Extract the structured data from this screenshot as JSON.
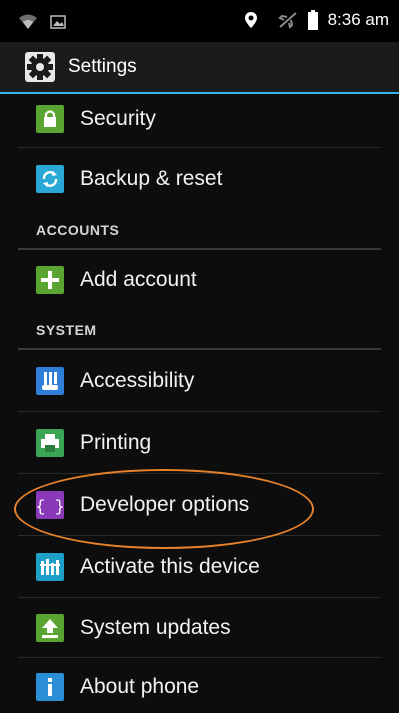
{
  "status_bar": {
    "time": "8:36 am",
    "icons": [
      "wifi-icon",
      "image-icon",
      "location-icon",
      "airplane-mode-icon",
      "battery-icon"
    ]
  },
  "action_bar": {
    "title": "Settings",
    "icon": "gear-icon",
    "accent_color": "#33b5e5"
  },
  "settings": {
    "security": {
      "label": "Security",
      "icon": "lock-icon",
      "color": "#5aa531"
    },
    "backup": {
      "label": "Backup & reset",
      "icon": "sync-icon",
      "color": "#2aa9d6"
    },
    "accounts_header": "ACCOUNTS",
    "add_account": {
      "label": "Add account",
      "icon": "plus-icon",
      "color": "#5aa531"
    },
    "system_header": "SYSTEM",
    "accessibility": {
      "label": "Accessibility",
      "icon": "accessibility-icon",
      "color": "#2f7fd8"
    },
    "printing": {
      "label": "Printing",
      "icon": "printer-icon",
      "color": "#3aa655"
    },
    "developer": {
      "label": "Developer options",
      "icon": "braces-icon",
      "color": "#8a3ab9",
      "highlighted": true
    },
    "activate": {
      "label": "Activate this device",
      "icon": "activate-icon",
      "color": "#1e9fc8"
    },
    "updates": {
      "label": "System updates",
      "icon": "upload-arrow-icon",
      "color": "#5aa531"
    },
    "about": {
      "label": "About phone",
      "icon": "info-icon",
      "color": "#2a8fd6"
    }
  },
  "highlight_color": "#e8822a"
}
